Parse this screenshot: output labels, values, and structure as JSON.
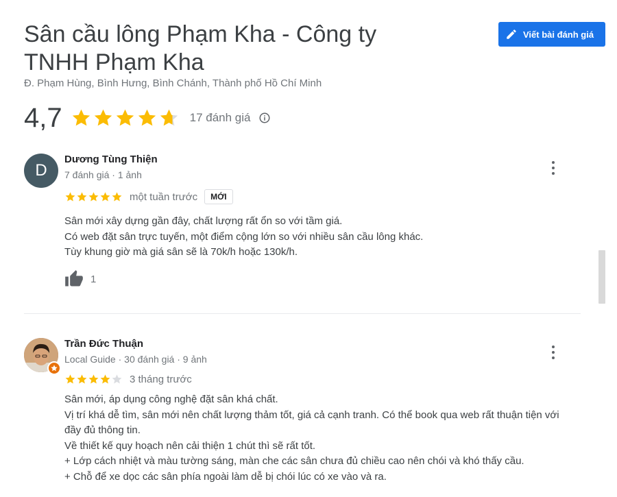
{
  "place": {
    "title": "Sân cầu lông Phạm Kha - Công ty TNHH Phạm Kha",
    "address": "Đ. Phạm Hùng, Bình Hưng, Bình Chánh, Thành phố Hồ Chí Minh",
    "rating": "4,7",
    "rating_value": 4.7,
    "review_count": "17 đánh giá"
  },
  "toolbar": {
    "write_review_label": "Viết bài đánh giá"
  },
  "colors": {
    "accent": "#1a73e8",
    "star": "#fbbc04",
    "star_empty": "#dadce0",
    "guide_badge": "#e8710a"
  },
  "reviews": [
    {
      "author": "Dương Tùng Thiện",
      "avatar_letter": "D",
      "meta": "7 đánh giá · 1 ảnh",
      "stars": 5,
      "time": "một tuần trước",
      "badge": "MỚI",
      "text": "Sân mới xây dựng gần đây, chất lượng rất ổn so với tầm giá.\nCó web đặt sân trực tuyến, một điểm cộng lớn so với nhiều sân cầu lông khác.\nTùy khung giờ mà giá sân sẽ là 70k/h hoặc 130k/h.",
      "likes": "1"
    },
    {
      "author": "Trần Đức Thuận",
      "meta": "Local Guide · 30 đánh giá · 9 ảnh",
      "stars": 4,
      "time": "3 tháng trước",
      "text": "Sân mới, áp dụng công nghệ đặt sân khá chất.\nVị trí khá dễ tìm, sân mới nên chất lượng thảm tốt, giá cả cạnh tranh. Có thể book qua web rất thuận tiện với đầy đủ thông tin.\nVề thiết kế quy hoạch nên cải thiện 1 chút thì sẽ rất tốt.\n+ Lớp cách nhiệt và màu tường sáng, màn che các sân chưa đủ chiều cao nên chói và khó thấy cầu.\n+ Chỗ để xe dọc các sân phía ngoài làm dễ bị chói lúc có xe vào và ra."
    }
  ]
}
